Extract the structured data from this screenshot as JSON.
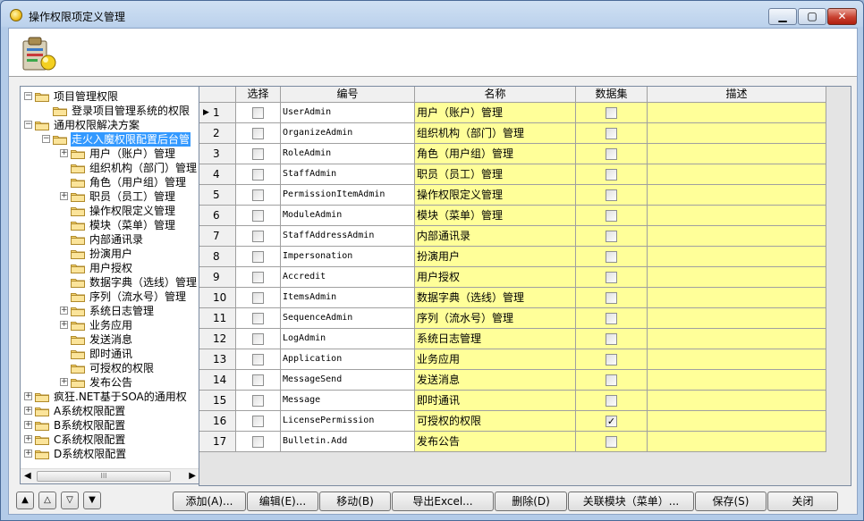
{
  "window": {
    "title": "操作权限项定义管理",
    "min_label": "▁",
    "max_label": "▢",
    "close_label": "✕"
  },
  "tree": {
    "scroll_left": "◀",
    "scroll_right": "▶",
    "thumb_label": "III",
    "nodes": [
      {
        "label": "项目管理权限",
        "level": 0,
        "expander": "minus"
      },
      {
        "label": "登录项目管理系统的权限",
        "level": 1,
        "expander": ""
      },
      {
        "label": "通用权限解决方案",
        "level": 0,
        "expander": "minus"
      },
      {
        "label": "走火入魔权限配置后台管",
        "level": 1,
        "expander": "minus",
        "selected": true
      },
      {
        "label": "用户（账户）管理",
        "level": 2,
        "expander": "plus"
      },
      {
        "label": "组织机构（部门）管理",
        "level": 2,
        "expander": ""
      },
      {
        "label": "角色（用户组）管理",
        "level": 2,
        "expander": ""
      },
      {
        "label": "职员（员工）管理",
        "level": 2,
        "expander": "plus"
      },
      {
        "label": "操作权限定义管理",
        "level": 2,
        "expander": ""
      },
      {
        "label": "模块（菜单）管理",
        "level": 2,
        "expander": ""
      },
      {
        "label": "内部通讯录",
        "level": 2,
        "expander": ""
      },
      {
        "label": "扮演用户",
        "level": 2,
        "expander": ""
      },
      {
        "label": "用户授权",
        "level": 2,
        "expander": ""
      },
      {
        "label": "数据字典（选线）管理",
        "level": 2,
        "expander": ""
      },
      {
        "label": "序列（流水号）管理",
        "level": 2,
        "expander": ""
      },
      {
        "label": "系统日志管理",
        "level": 2,
        "expander": "plus"
      },
      {
        "label": "业务应用",
        "level": 2,
        "expander": "plus"
      },
      {
        "label": "发送消息",
        "level": 2,
        "expander": ""
      },
      {
        "label": "即时通讯",
        "level": 2,
        "expander": ""
      },
      {
        "label": "可授权的权限",
        "level": 2,
        "expander": ""
      },
      {
        "label": "发布公告",
        "level": 2,
        "expander": "plus"
      },
      {
        "label": "疯狂.NET基于SOA的通用权",
        "level": 0,
        "expander": "plus"
      },
      {
        "label": "A系统权限配置",
        "level": 0,
        "expander": "plus"
      },
      {
        "label": "B系统权限配置",
        "level": 0,
        "expander": "plus"
      },
      {
        "label": "C系统权限配置",
        "level": 0,
        "expander": "plus"
      },
      {
        "label": "D系统权限配置",
        "level": 0,
        "expander": "plus"
      }
    ]
  },
  "grid": {
    "columns": [
      "选择",
      "编号",
      "名称",
      "数据集",
      "描述"
    ],
    "current_row_marker": "▶",
    "rows": [
      {
        "num": "1",
        "code": "UserAdmin",
        "name": "用户（账户）管理",
        "dataset": false
      },
      {
        "num": "2",
        "code": "OrganizeAdmin",
        "name": "组织机构（部门）管理",
        "dataset": false
      },
      {
        "num": "3",
        "code": "RoleAdmin",
        "name": "角色（用户组）管理",
        "dataset": false
      },
      {
        "num": "4",
        "code": "StaffAdmin",
        "name": "职员（员工）管理",
        "dataset": false
      },
      {
        "num": "5",
        "code": "PermissionItemAdmin",
        "name": "操作权限定义管理",
        "dataset": false
      },
      {
        "num": "6",
        "code": "ModuleAdmin",
        "name": "模块（菜单）管理",
        "dataset": false
      },
      {
        "num": "7",
        "code": "StaffAddressAdmin",
        "name": "内部通讯录",
        "dataset": false
      },
      {
        "num": "8",
        "code": "Impersonation",
        "name": "扮演用户",
        "dataset": false
      },
      {
        "num": "9",
        "code": "Accredit",
        "name": "用户授权",
        "dataset": false
      },
      {
        "num": "10",
        "code": "ItemsAdmin",
        "name": "数据字典（选线）管理",
        "dataset": false
      },
      {
        "num": "11",
        "code": "SequenceAdmin",
        "name": "序列（流水号）管理",
        "dataset": false
      },
      {
        "num": "12",
        "code": "LogAdmin",
        "name": "系统日志管理",
        "dataset": false
      },
      {
        "num": "13",
        "code": "Application",
        "name": "业务应用",
        "dataset": false
      },
      {
        "num": "14",
        "code": "MessageSend",
        "name": "发送消息",
        "dataset": false
      },
      {
        "num": "15",
        "code": "Message",
        "name": "即时通讯",
        "dataset": false
      },
      {
        "num": "16",
        "code": "LicensePermission",
        "name": "可授权的权限",
        "dataset": true
      },
      {
        "num": "17",
        "code": "Bulletin.Add",
        "name": "发布公告",
        "dataset": false
      }
    ]
  },
  "nav_buttons": [
    "▲",
    "△",
    "▽",
    "▼"
  ],
  "buttons": {
    "add": "添加(A)...",
    "edit": "编辑(E)...",
    "move": "移动(B)",
    "export": "导出Excel...",
    "delete": "删除(D)",
    "related": "关联模块（菜单）...",
    "save": "保存(S)",
    "close": "关闭"
  },
  "colors": {
    "name_cell_bg": "#ffff99",
    "selection_bg": "#3399ff"
  }
}
